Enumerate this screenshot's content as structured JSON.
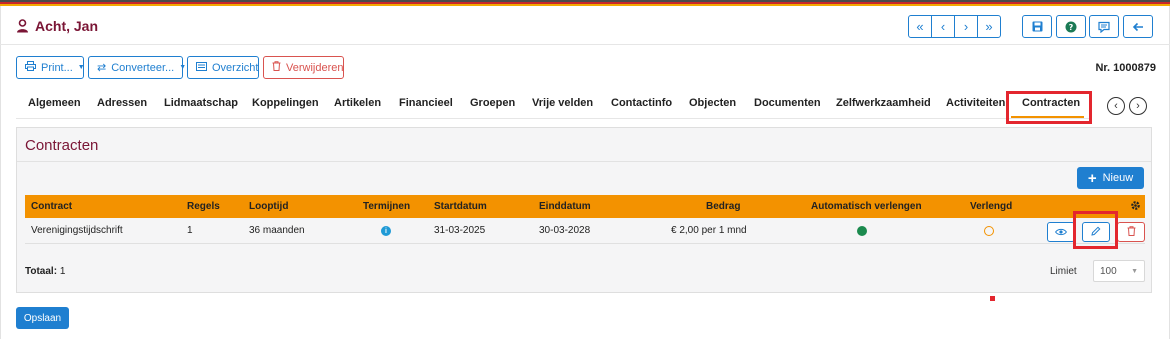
{
  "header": {
    "title": "Acht, Jan",
    "record_number": "Nr. 1000879"
  },
  "toolbar": {
    "print_label": "Print...",
    "convert_label": "Converteer...",
    "overview_label": "Overzicht",
    "delete_label": "Verwijderen"
  },
  "nav_icons": [
    "first-icon",
    "previous-icon",
    "next-icon",
    "last-icon"
  ],
  "action_icons": [
    "save-icon",
    "help-icon",
    "comment-icon",
    "back-icon"
  ],
  "tabs": [
    {
      "label": "Algemeen"
    },
    {
      "label": "Adressen"
    },
    {
      "label": "Lidmaatschap"
    },
    {
      "label": "Koppelingen"
    },
    {
      "label": "Artikelen"
    },
    {
      "label": "Financieel"
    },
    {
      "label": "Groepen"
    },
    {
      "label": "Vrije velden"
    },
    {
      "label": "Contactinfo"
    },
    {
      "label": "Objecten"
    },
    {
      "label": "Documenten"
    },
    {
      "label": "Zelfwerkzaamheid"
    },
    {
      "label": "Activiteiten"
    },
    {
      "label": "Contracten",
      "active": true
    }
  ],
  "panel": {
    "title": "Contracten",
    "new_label": "Nieuw",
    "columns": [
      "Contract",
      "Regels",
      "Looptijd",
      "Termijnen",
      "Startdatum",
      "Einddatum",
      "Bedrag",
      "Automatisch verlengen",
      "Verlengd"
    ],
    "rows": [
      {
        "contract": "Verenigingstijdschrift",
        "regels": "1",
        "looptijd": "36 maanden",
        "termijnen_icon": "info-icon",
        "startdatum": "31-03-2025",
        "einddatum": "30-03-2028",
        "bedrag": "€ 2,00 per 1 mnd",
        "automatisch_verlengen": true,
        "verlengd": false
      }
    ],
    "total_label": "Totaal:",
    "total_value": "1",
    "limit_label": "Limiet",
    "limit_value": "100"
  },
  "footer": {
    "save_label": "Opslaan"
  },
  "colors": {
    "accent_blue": "#1f7fd0",
    "title_maroon": "#7a1535",
    "table_header_orange": "#f39200",
    "delete_red": "#d9534f",
    "highlight_red": "#e3262e",
    "status_green": "#1b8a4e"
  }
}
